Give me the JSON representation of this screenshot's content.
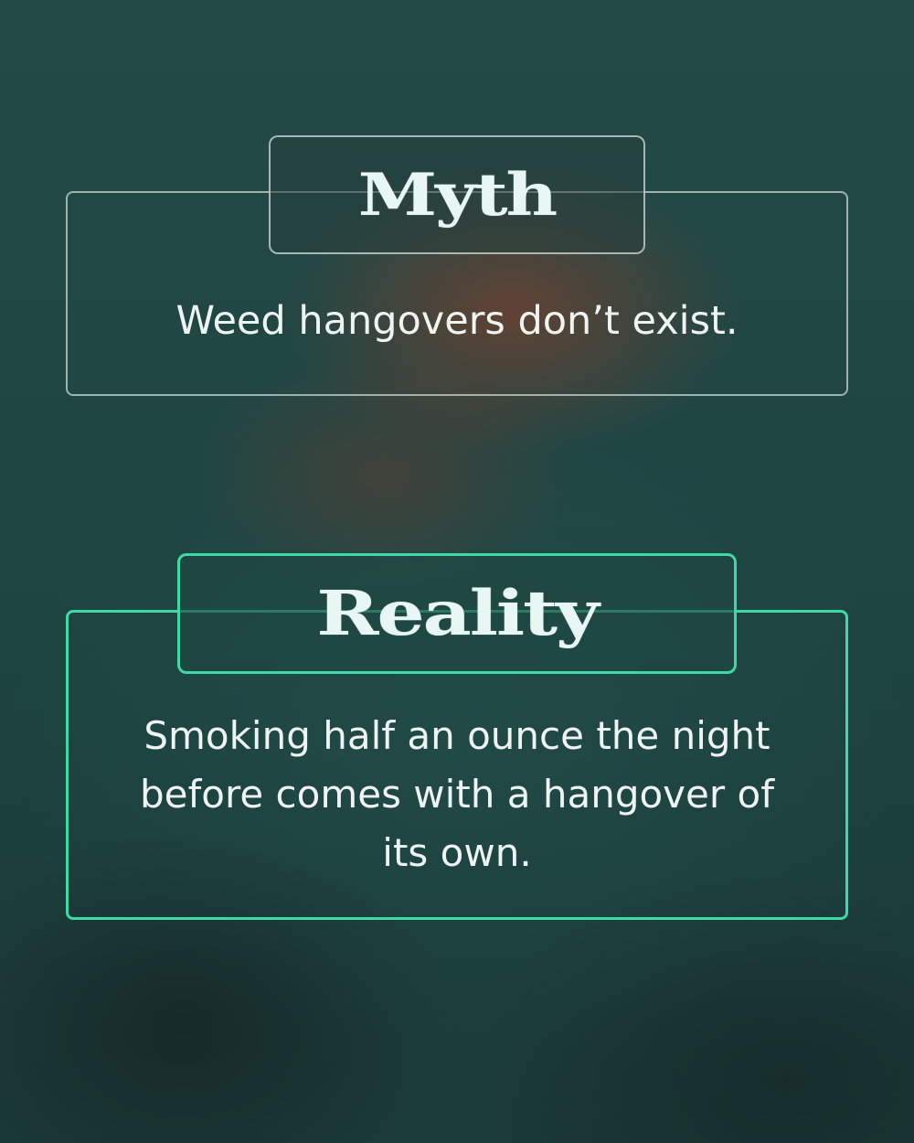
{
  "myth": {
    "heading": "Myth",
    "text": "Weed hangovers don’t exist."
  },
  "reality": {
    "heading": "Reality",
    "text": "Smoking half an ounce the night before comes with a hangover of its own."
  },
  "colors": {
    "background": "#1f4441",
    "myth_border": "#c8d6d2",
    "reality_border": "#3fd9a6",
    "text": "#eef4f2"
  }
}
